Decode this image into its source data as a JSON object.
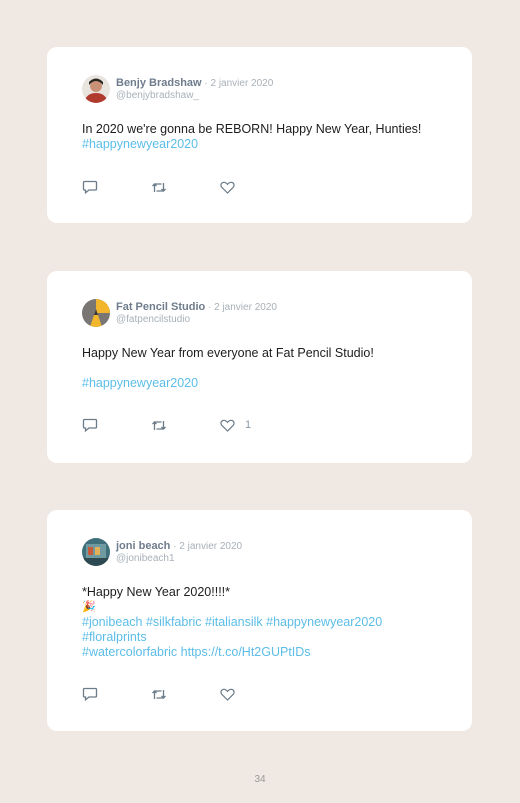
{
  "tweets": [
    {
      "name": "Benjy Bradshaw",
      "separator": " · ",
      "date": "2 janvier 2020",
      "handle": "@benjybradshaw_",
      "text_plain": "In 2020 we're gonna be REBORN! Happy New Year, Hunties! ",
      "text_tag": "#happynewyear2020",
      "likes": ""
    },
    {
      "name": "Fat Pencil Studio",
      "separator": " · ",
      "date": "2 janvier 2020",
      "handle": "@fatpencilstudio",
      "text_plain": "Happy New Year from everyone at Fat Pencil Studio!",
      "text_tag": "#happynewyear2020",
      "likes": "1"
    },
    {
      "name": "joni beach",
      "separator": " · ",
      "date": "2 janvier 2020",
      "handle": "@jonibeach1",
      "text_plain": "*Happy New Year 2020!!!!*",
      "emoji": "🎉",
      "tags_line1": "#jonibeach #silkfabric #italiansilk #happynewyear2020",
      "tags_line2": "#floralprints",
      "tags_line3": "#watercolorfabric https://t.co/Ht2GUPtIDs",
      "likes": ""
    }
  ],
  "page_number": "34",
  "colors": {
    "background": "#f0e8e3",
    "card": "#ffffff",
    "link": "#5bbde8",
    "name": "#6f7c8c",
    "muted": "#a8b0b8"
  },
  "icons": [
    "reply-icon",
    "retweet-icon",
    "like-icon"
  ]
}
